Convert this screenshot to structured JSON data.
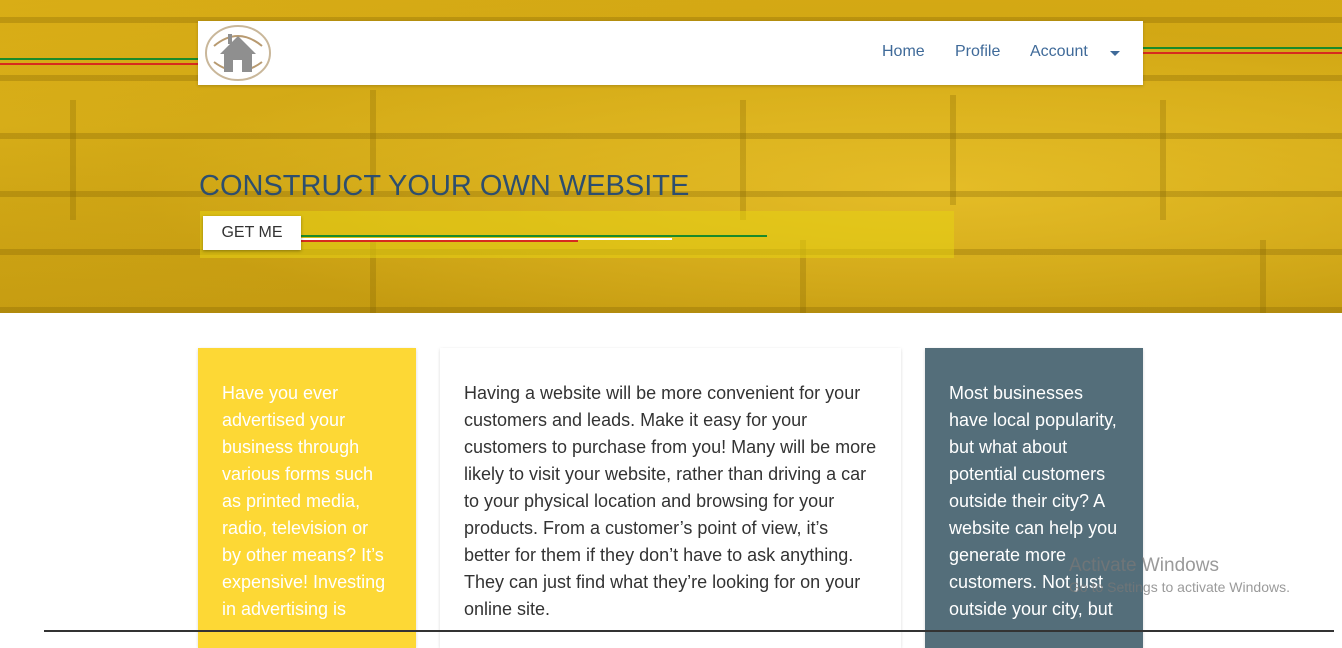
{
  "colors": {
    "nav_link": "#3f6a99",
    "title": "#2d4e6e",
    "card_yellow": "#fdd835",
    "card_white": "#ffffff",
    "card_slate": "#546e7a",
    "stripe_green": "#1a8a2a",
    "stripe_red": "#d62b1e"
  },
  "navbar": {
    "logo_icon": "house-logo-icon",
    "links": [
      "Home",
      "Profile",
      "Account"
    ],
    "dropdown_icon": "caret-down-icon"
  },
  "hero": {
    "title": "CONSTRUCT YOUR OWN WEBSITE",
    "button_label": "GET ME"
  },
  "cards": {
    "left": "Have you ever advertised your business through various forms such as printed media, radio, television or by other means? It’s expensive! Investing in advertising is",
    "middle": "Having a website will be more convenient for your customers and leads. Make it easy for your customers to purchase from you! Many will be more likely to visit your website, rather than driving a car to your physical location and browsing for your products. From a customer’s point of view, it’s better for them if they don’t have to ask anything. They can just find what they’re looking for on your online site.",
    "right": "Most businesses have local popularity, but what about potential customers outside their city? A website can help you generate more customers. Not just outside your city, but"
  },
  "watermark": {
    "title": "Activate Windows",
    "subtitle": "Go to Settings to activate Windows."
  }
}
